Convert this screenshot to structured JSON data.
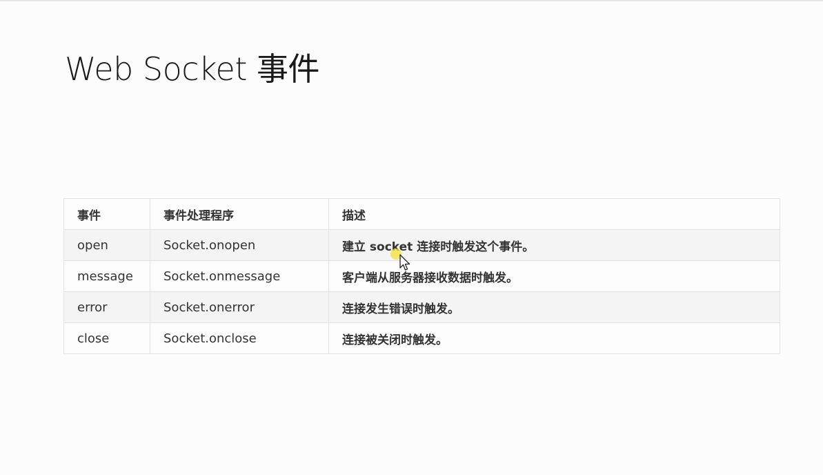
{
  "slide": {
    "title": "Web Socket 事件"
  },
  "table": {
    "headers": {
      "event": "事件",
      "handler": "事件处理程序",
      "description": "描述"
    },
    "rows": [
      {
        "event": "open",
        "handler": "Socket.onopen",
        "description": "建立 socket 连接时触发这个事件。"
      },
      {
        "event": "message",
        "handler": "Socket.onmessage",
        "description": "客户端从服务器接收数据时触发。"
      },
      {
        "event": "error",
        "handler": "Socket.onerror",
        "description": "连接发生错误时触发。"
      },
      {
        "event": "close",
        "handler": "Socket.onclose",
        "description": "连接被关闭时触发。"
      }
    ]
  },
  "cursor": {
    "icon": "mouse-pointer-icon",
    "highlight_color": "#f5e03c"
  }
}
